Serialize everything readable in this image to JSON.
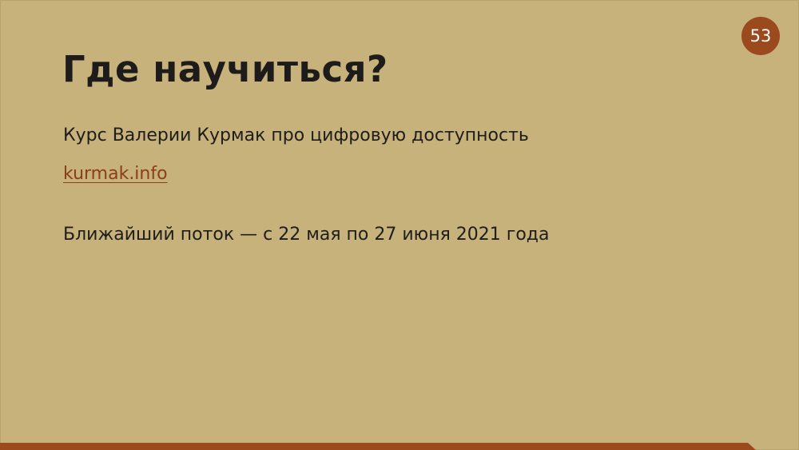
{
  "slide": {
    "number": "53",
    "title": "Где научиться?",
    "course_text": "Курс Валерии Курмак про цифровую доступность",
    "link_text": "kurmak.info",
    "next_stream_text": "Ближайший поток — с 22 мая по 27 июня 2021 года"
  },
  "colors": {
    "background": "#c7b27b",
    "accent": "#9b4a1e",
    "link": "#8a3f16",
    "text": "#1f1d1a"
  }
}
